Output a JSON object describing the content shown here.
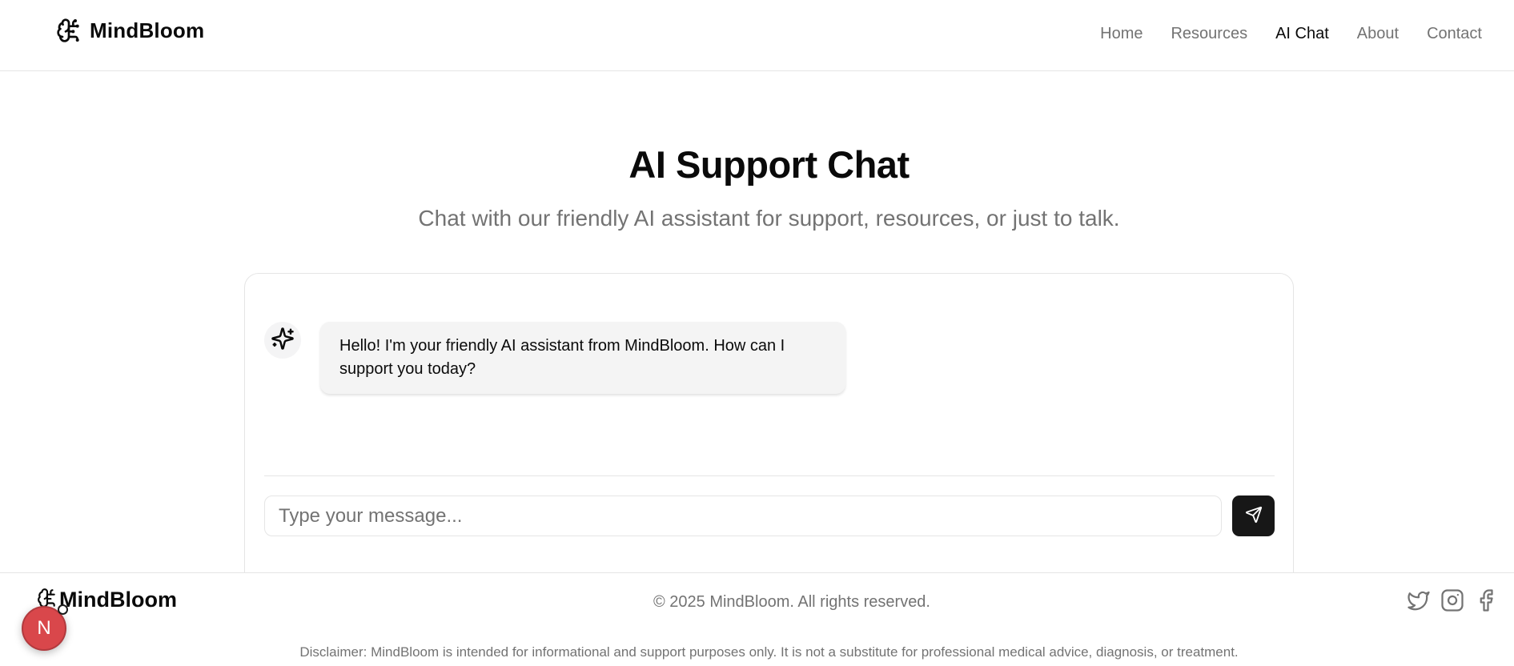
{
  "header": {
    "brand": "MindBloom",
    "nav": [
      {
        "label": "Home",
        "active": false
      },
      {
        "label": "Resources",
        "active": false
      },
      {
        "label": "AI Chat",
        "active": true
      },
      {
        "label": "About",
        "active": false
      },
      {
        "label": "Contact",
        "active": false
      }
    ]
  },
  "hero": {
    "title": "AI Support Chat",
    "subtitle": "Chat with our friendly AI assistant for support, resources, or just to talk."
  },
  "chat": {
    "messages": [
      {
        "sender": "assistant",
        "avatar_icon": "sparkles-icon",
        "text": "Hello! I'm your friendly AI assistant from MindBloom. How can I support you today?"
      }
    ],
    "input": {
      "value": "",
      "placeholder": "Type your message..."
    },
    "send_icon": "send-icon"
  },
  "footer": {
    "brand": "MindBloom",
    "copyright": "© 2025 MindBloom. All rights reserved.",
    "socials": [
      "twitter-icon",
      "instagram-icon",
      "facebook-icon"
    ],
    "disclaimer": "Disclaimer: MindBloom is intended for informational and support purposes only. It is not a substitute for professional medical advice, diagnosis, or treatment."
  },
  "dev_badge": {
    "letter": "N"
  },
  "colors": {
    "text": "#0a0a0a",
    "muted": "#737373",
    "border": "#e5e5e5",
    "bubble": "#f4f4f4",
    "send_button": "#171717",
    "badge": "#d9474b"
  }
}
